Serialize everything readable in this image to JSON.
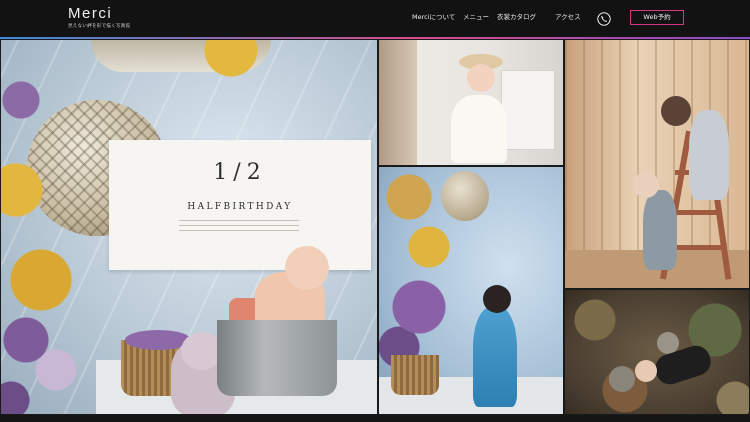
{
  "header": {
    "logo_title": "Merci",
    "logo_tagline": "見えない絆を形で描く写真館",
    "nav": {
      "about": "Merciについて",
      "menu": "メニュー",
      "costume_catalog": "衣裳カタログ",
      "access": "アクセス"
    },
    "phone_icon": "phone-icon",
    "reserve_button": "Web予約",
    "accent_color": "#d23a7c"
  },
  "gallery": {
    "tiles": [
      {
        "name": "half-birthday-photo",
        "banner_number": "1/2",
        "banner_text": "HALFBIRTHDAY"
      },
      {
        "name": "girl-white-dress-photo"
      },
      {
        "name": "children-ladder-photo"
      },
      {
        "name": "kimono-girl-photo"
      },
      {
        "name": "baby-flowerbed-photo"
      }
    ]
  }
}
